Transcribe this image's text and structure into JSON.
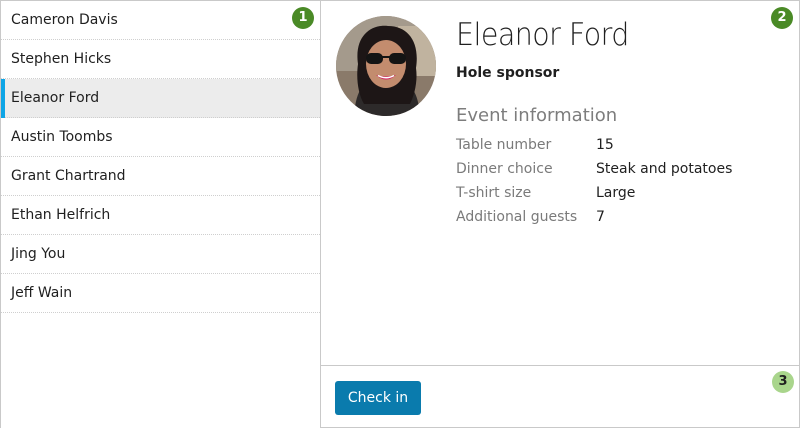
{
  "people": [
    {
      "name": "Cameron Davis"
    },
    {
      "name": "Stephen Hicks"
    },
    {
      "name": "Eleanor Ford"
    },
    {
      "name": "Austin Toombs"
    },
    {
      "name": "Grant Chartrand"
    },
    {
      "name": "Ethan Helfrich"
    },
    {
      "name": "Jing You"
    },
    {
      "name": "Jeff Wain"
    }
  ],
  "selected_index": 2,
  "detail": {
    "name": "Eleanor Ford",
    "role": "Hole sponsor",
    "section_title": "Event information",
    "fields": [
      {
        "label": "Table number",
        "value": "15"
      },
      {
        "label": "Dinner choice",
        "value": "Steak and potatoes"
      },
      {
        "label": "T-shirt size",
        "value": "Large"
      },
      {
        "label": "Additional guests",
        "value": "7"
      }
    ]
  },
  "footer": {
    "checkin_label": "Check in"
  },
  "callouts": [
    "1",
    "2",
    "3"
  ],
  "colors": {
    "accent": "#0ea5e6",
    "button": "#0a7bad",
    "callout_dark": "#4a8a26",
    "callout_light": "#a9d58c"
  }
}
